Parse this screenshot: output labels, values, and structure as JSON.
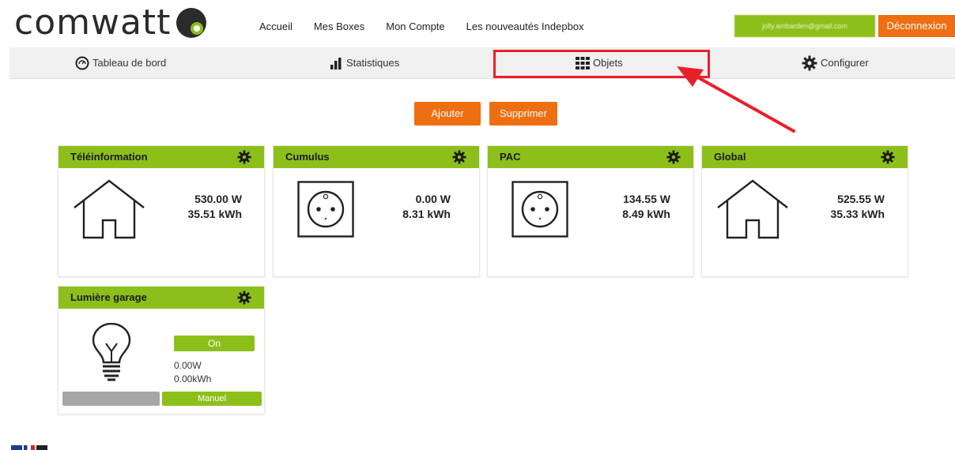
{
  "brand": {
    "logo_text": "comwatt"
  },
  "topnav": {
    "items": [
      "Accueil",
      "Mes Boxes",
      "Mon Compte",
      "Les nouveautés Indepbox"
    ]
  },
  "account": {
    "email": "jolly.ambarden@gmail.com",
    "logout_label": "Déconnexion"
  },
  "mainnav": {
    "items": [
      {
        "label": "Tableau de bord",
        "icon": "dashboard-icon"
      },
      {
        "label": "Statistiques",
        "icon": "bar-chart-icon"
      },
      {
        "label": "Objets",
        "icon": "grid-icon"
      },
      {
        "label": "Configurer",
        "icon": "gear-icon"
      }
    ],
    "highlighted": "Objets"
  },
  "actions": {
    "add_label": "Ajouter",
    "delete_label": "Supprimer"
  },
  "colors": {
    "accent_green": "#8dbf1b",
    "accent_orange": "#ee6f12",
    "highlight_red": "#e8202a"
  },
  "cards": [
    {
      "title": "Téléinformation",
      "icon": "house-icon",
      "power": "530.00 W",
      "energy": "35.51 kWh"
    },
    {
      "title": "Cumulus",
      "icon": "socket-icon",
      "power": "0.00 W",
      "energy": "8.31 kWh"
    },
    {
      "title": "PAC",
      "icon": "socket-icon",
      "power": "134.55 W",
      "energy": "8.49 kWh"
    },
    {
      "title": "Global",
      "icon": "house-icon",
      "power": "525.55 W",
      "energy": "35.33 kWh"
    }
  ],
  "light_card": {
    "title": "Lumière garage",
    "icon": "lightbulb-icon",
    "state_label": "On",
    "power": "0.00W",
    "energy": "0.00kWh",
    "mode_label": "Manuel"
  }
}
